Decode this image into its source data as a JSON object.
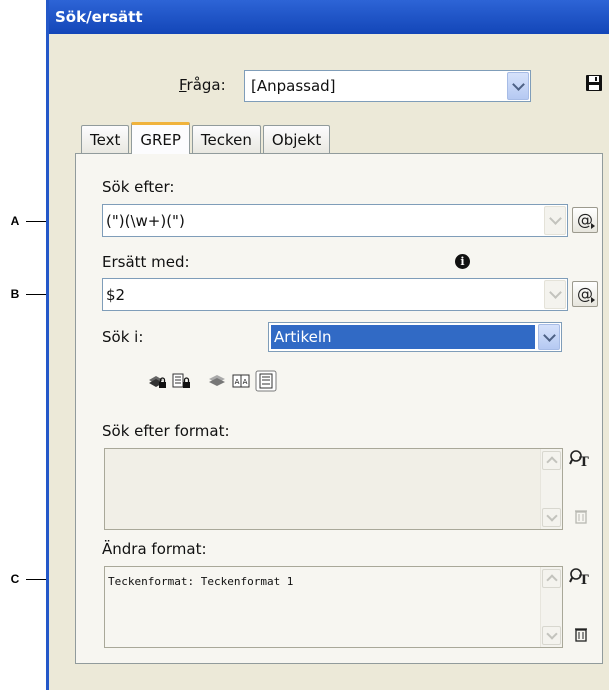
{
  "dialog": {
    "title": "Sök/ersätt"
  },
  "query": {
    "label": "Fråga:",
    "value": "[Anpassad]"
  },
  "tabs": [
    {
      "label": "Text",
      "active": false
    },
    {
      "label": "GREP",
      "active": true
    },
    {
      "label": "Tecken",
      "active": false
    },
    {
      "label": "Objekt",
      "active": false
    }
  ],
  "find": {
    "label": "Sök efter:",
    "value": "(\")(\\w+)(\")",
    "special_button": "@"
  },
  "replace": {
    "label": "Ersätt med:",
    "value": "$2",
    "special_button": "@"
  },
  "search_in": {
    "label": "Sök i:",
    "value": "Artikeln"
  },
  "find_format": {
    "label": "Sök efter format:",
    "value": ""
  },
  "change_format": {
    "label": "Ändra format:",
    "value": "Teckenformat: Teckenformat 1"
  },
  "callouts": {
    "a": "A",
    "b": "B",
    "c": "C"
  },
  "icons": {
    "save": "floppy-disk-icon",
    "info": "info-icon",
    "special_chars": "at-sign-menu-icon",
    "locked_layers": "locked-layers-icon",
    "locked_stories": "locked-stories-icon",
    "hidden_layers": "hidden-layers-icon",
    "master_pages": "master-pages-icon",
    "footnotes": "footnotes-icon",
    "format_settings": "text-format-icon",
    "delete": "trash-icon"
  },
  "colors": {
    "titlebar": "#1f57c8",
    "selection": "#316ac5",
    "active_tab_accent": "#f0b33c"
  }
}
